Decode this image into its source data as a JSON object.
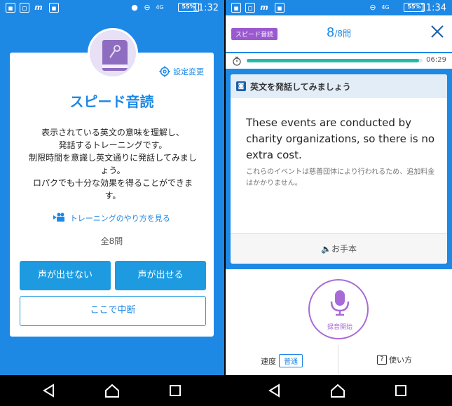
{
  "left": {
    "status": {
      "time": "11:32",
      "battery": "55%",
      "net": "4G"
    },
    "settings_label": "設定変更",
    "title": "スピード音読",
    "description": [
      "表示されている英文の意味を理解し、",
      "発話するトレーニングです。",
      "制限時間を意識し英文通りに発話してみまし",
      "ょう。",
      "ロパクでも十分な効果を得ることができま",
      "す。"
    ],
    "howto_label": "トレーニングのやり方を見る",
    "count_label": "全8問",
    "btn_cannot": "声が出せない",
    "btn_can": "声が出せる",
    "btn_suspend": "ここで中断"
  },
  "right": {
    "status": {
      "time": "11:34",
      "battery": "55%",
      "net": "4G"
    },
    "badge": "スピード音読",
    "progress_current": "8",
    "progress_total": "/8問",
    "timer": {
      "remaining_label": "06:29",
      "fraction": 0.98
    },
    "prompt_header": "英文を発話してみましょう",
    "english": "These events are conducted by charity organizations, so there is no extra cost.",
    "japanese": "これらのイベントは慈善団体により行われるため、追加料金はかかりません。",
    "sample_label": "お手本",
    "record_label": "録音開始",
    "speed_label": "速度",
    "speed_value": "普通",
    "help_label": "使い方"
  },
  "colors": {
    "primary": "#1e88e5",
    "button": "#1e9be0",
    "purple": "#a86bd6",
    "teal": "#26b8a8"
  }
}
